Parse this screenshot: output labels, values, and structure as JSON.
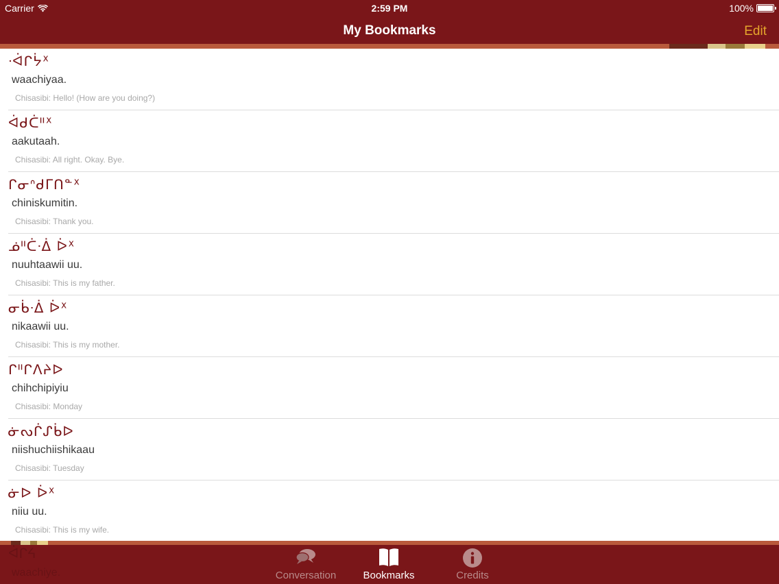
{
  "status_bar": {
    "carrier": "Carrier",
    "time": "2:59 PM",
    "battery": "100%",
    "wifi_icon": "wifi-icon",
    "battery_icon": "battery-icon"
  },
  "nav": {
    "title": "My Bookmarks",
    "edit_label": "Edit"
  },
  "colors": {
    "bar": "#7a1619",
    "accent": "#e5a52c",
    "stripe": "#b95a3c",
    "syllabics": "#7a1619"
  },
  "bookmarks": [
    {
      "syllabics": "ᐧᐋᒋᔮᕽ",
      "roman": "waachiyaa.",
      "translation": "Chisasibi: Hello! (How are you doing?)"
    },
    {
      "syllabics": "ᐋᑯᑖᐦᕽ",
      "roman": "aakutaah.",
      "translation": "Chisasibi: All right. Okay. Bye."
    },
    {
      "syllabics": "ᒋᓂᐢᑯᒥᑎᓐᕽ",
      "roman": "chiniskumitin.",
      "translation": "Chisasibi: Thank you."
    },
    {
      "syllabics": "ᓅᐦᑖᐧᐄ ᐆᕽ",
      "roman": "nuuhtaawii uu.",
      "translation": "Chisasibi: This is my father."
    },
    {
      "syllabics": "ᓂᑳᐧᐄ ᐆᕽ",
      "roman": "nikaawii uu.",
      "translation": "Chisasibi: This is my mother."
    },
    {
      "syllabics": "ᒋᐦᒋᐱᔨᐅ",
      "roman": "chihchipiyiu",
      "translation": "Chisasibi: Monday"
    },
    {
      "syllabics": "ᓃᔓᒌᔑᑳᐅ",
      "roman": "niishuchiishikaau",
      "translation": "Chisasibi: Tuesday"
    },
    {
      "syllabics": "ᓃᐅ ᐆᕽ",
      "roman": "niiu uu.",
      "translation": "Chisasibi: This is my wife."
    }
  ],
  "peek_row": {
    "syllabics": "ᐋᒋᔦ",
    "roman": "waachiye."
  },
  "tabs": [
    {
      "label": "Conversation",
      "icon": "chat-bubbles-icon",
      "active": false
    },
    {
      "label": "Bookmarks",
      "icon": "open-book-icon",
      "active": true
    },
    {
      "label": "Credits",
      "icon": "info-icon",
      "active": false
    }
  ]
}
